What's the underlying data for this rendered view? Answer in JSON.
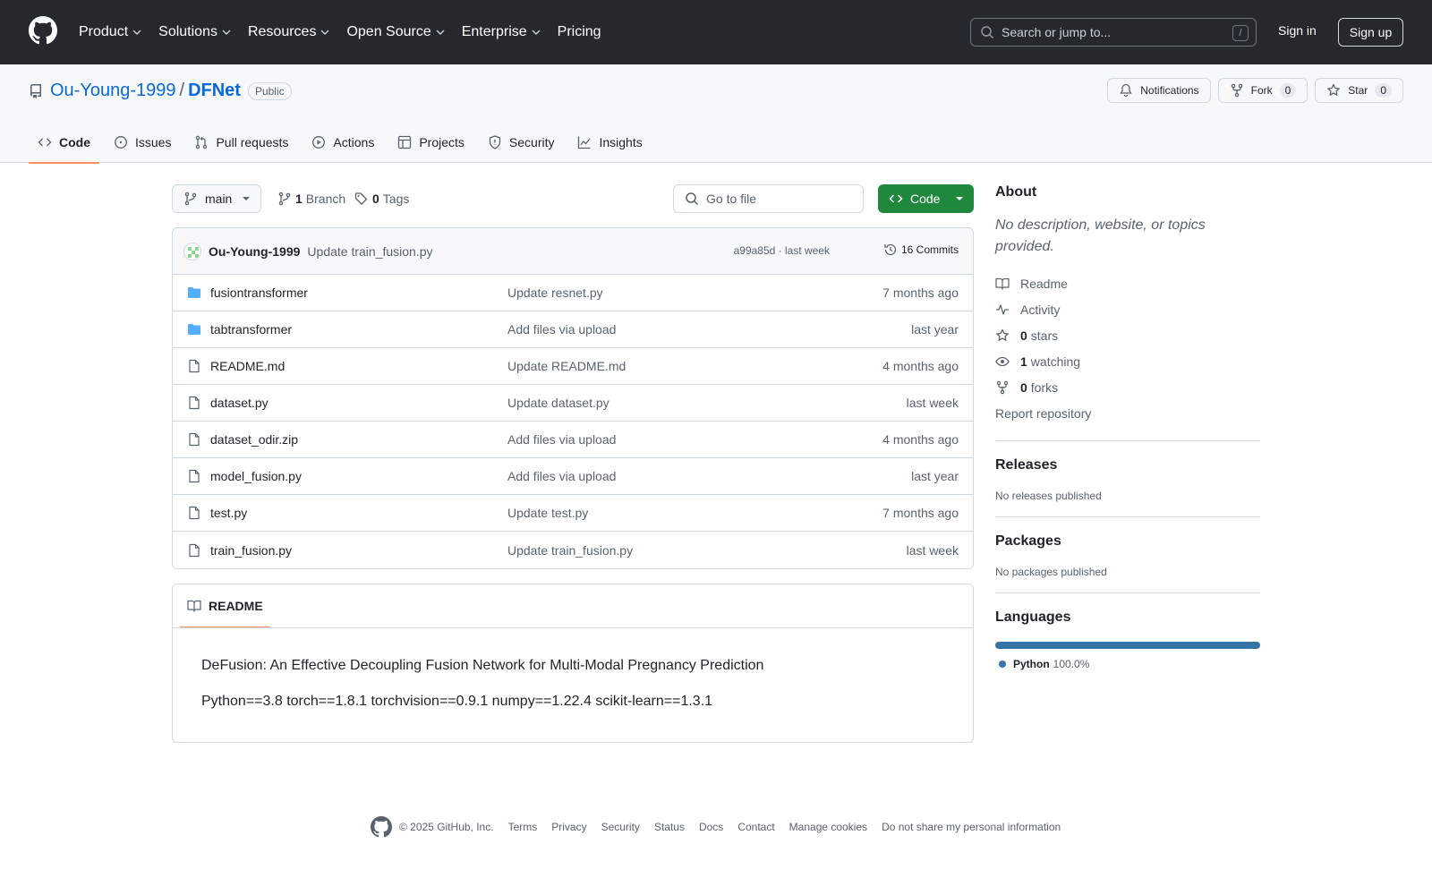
{
  "header": {
    "nav": [
      "Product",
      "Solutions",
      "Resources",
      "Open Source",
      "Enterprise",
      "Pricing"
    ],
    "search_placeholder": "Search or jump to...",
    "search_shortcut": "/",
    "sign_in": "Sign in",
    "sign_up": "Sign up"
  },
  "repo": {
    "owner": "Ou-Young-1999",
    "separator": "/",
    "name": "DFNet",
    "visibility": "Public",
    "notifications_label": "Notifications",
    "fork_label": "Fork",
    "fork_count": "0",
    "star_label": "Star",
    "star_count": "0",
    "tabs": [
      "Code",
      "Issues",
      "Pull requests",
      "Actions",
      "Projects",
      "Security",
      "Insights"
    ]
  },
  "toolbar": {
    "branch": "main",
    "branch_count": "1",
    "branch_label": "Branch",
    "tag_count": "0",
    "tag_label": "Tags",
    "goto_file": "Go to file",
    "code_button": "Code"
  },
  "commit": {
    "author": "Ou-Young-1999",
    "message": "Update train_fusion.py",
    "meta": "a99a85d · last week",
    "commits_label": "16 Commits"
  },
  "files": [
    {
      "name": "fusiontransformer",
      "type": "folder",
      "commit": "Update resnet.py",
      "age": "7 months ago"
    },
    {
      "name": "tabtransformer",
      "type": "folder",
      "commit": "Add files via upload",
      "age": "last year"
    },
    {
      "name": "README.md",
      "type": "file",
      "commit": "Update README.md",
      "age": "4 months ago"
    },
    {
      "name": "dataset.py",
      "type": "file",
      "commit": "Update dataset.py",
      "age": "last week"
    },
    {
      "name": "dataset_odir.zip",
      "type": "file",
      "commit": "Add files via upload",
      "age": "4 months ago"
    },
    {
      "name": "model_fusion.py",
      "type": "file",
      "commit": "Add files via upload",
      "age": "last year"
    },
    {
      "name": "test.py",
      "type": "file",
      "commit": "Update test.py",
      "age": "7 months ago"
    },
    {
      "name": "train_fusion.py",
      "type": "file",
      "commit": "Update train_fusion.py",
      "age": "last week"
    }
  ],
  "readme": {
    "tab_label": "README",
    "line1": "DeFusion: An Effective Decoupling Fusion Network for Multi-Modal Pregnancy Prediction",
    "line2": "Python==3.8 torch==1.8.1 torchvision==0.9.1 numpy==1.22.4 scikit-learn==1.3.1"
  },
  "sidebar": {
    "about_title": "About",
    "about_desc": "No description, website, or topics provided.",
    "readme": "Readme",
    "activity": "Activity",
    "stars_count": "0",
    "stars_label": "stars",
    "watching_count": "1",
    "watching_label": "watching",
    "forks_count": "0",
    "forks_label": "forks",
    "report": "Report repository",
    "releases_title": "Releases",
    "releases_desc": "No releases published",
    "packages_title": "Packages",
    "packages_desc": "No packages published",
    "languages_title": "Languages",
    "language_name": "Python",
    "language_percent": "100.0%",
    "language_color": "#3572a5"
  },
  "footer": {
    "copyright": "© 2025 GitHub, Inc.",
    "links": [
      "Terms",
      "Privacy",
      "Security",
      "Status",
      "Docs",
      "Contact",
      "Manage cookies",
      "Do not share my personal information"
    ]
  }
}
